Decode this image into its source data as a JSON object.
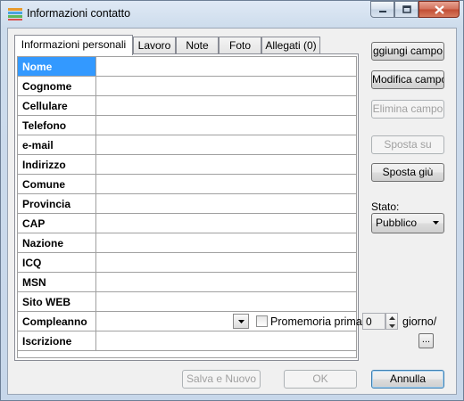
{
  "window": {
    "title": "Informazioni contatto",
    "icons": {
      "app": "address-book-icon",
      "minimize": "minimize-icon",
      "maximize": "maximize-icon",
      "close": "close-icon"
    }
  },
  "tabs": [
    {
      "label": "Informazioni personali",
      "active": true
    },
    {
      "label": "Lavoro",
      "active": false
    },
    {
      "label": "Note",
      "active": false
    },
    {
      "label": "Foto",
      "active": false
    },
    {
      "label": "Allegati (0)",
      "active": false
    }
  ],
  "fields": [
    {
      "label": "Nome",
      "value": "",
      "selected": true
    },
    {
      "label": "Cognome",
      "value": ""
    },
    {
      "label": "Cellulare",
      "value": ""
    },
    {
      "label": "Telefono",
      "value": ""
    },
    {
      "label": "e-mail",
      "value": ""
    },
    {
      "label": "Indirizzo",
      "value": ""
    },
    {
      "label": "Comune",
      "value": ""
    },
    {
      "label": "Provincia",
      "value": ""
    },
    {
      "label": "CAP",
      "value": ""
    },
    {
      "label": "Nazione",
      "value": ""
    },
    {
      "label": "ICQ",
      "value": ""
    },
    {
      "label": "MSN",
      "value": ""
    },
    {
      "label": "Sito WEB",
      "value": ""
    },
    {
      "label": "Compleanno",
      "value": ""
    },
    {
      "label": "Iscrizione",
      "value": ""
    }
  ],
  "birthday": {
    "reminder_label": "Promemoria prima",
    "reminder_checked": false,
    "days_value": "0",
    "after_label": "giorno/"
  },
  "iscrizione_button_label": "...",
  "side_buttons": {
    "add": "ggiungi campo",
    "modify": "Modifica campo",
    "delete": "Elimina campo",
    "move_up": "Sposta su",
    "move_down": "Sposta giù"
  },
  "stato": {
    "label": "Stato:",
    "value": "Pubblico"
  },
  "bottom_buttons": {
    "save_new": "Salva e Nuovo",
    "ok": "OK",
    "cancel": "Annulla"
  },
  "colors": {
    "selection": "#3399ff",
    "titlebar": "#c7d7ea",
    "close": "#c14c33"
  }
}
